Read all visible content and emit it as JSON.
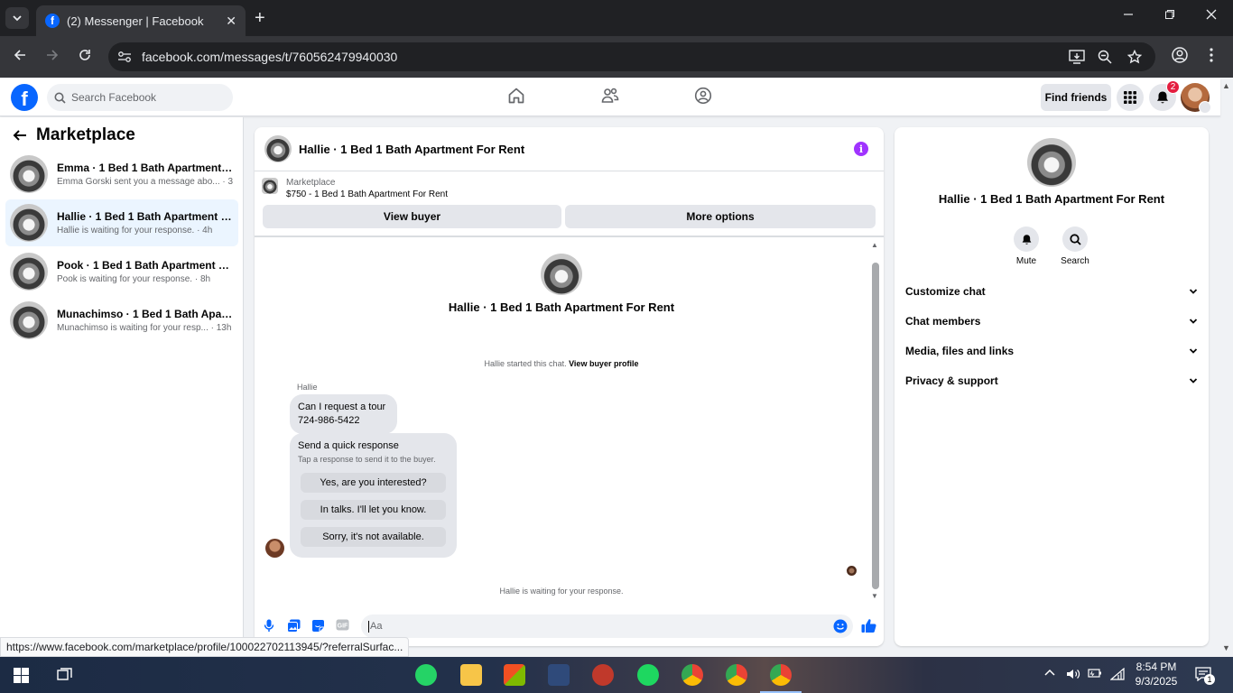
{
  "browser": {
    "tab_title": "(2) Messenger | Facebook",
    "favicon_letter": "f",
    "new_tab": "+",
    "close_tab": "✕",
    "url": "facebook.com/messages/t/760562479940030",
    "status_url": "https://www.facebook.com/marketplace/profile/100022702113945/?referralSurfac..."
  },
  "fb": {
    "logo_letter": "f",
    "search_placeholder": "Search Facebook",
    "find_friends": "Find friends",
    "notification_count": "2"
  },
  "left": {
    "title": "Marketplace",
    "conversations": [
      {
        "name": "Emma · 1 Bed 1 Bath Apartment Fo...",
        "sub": "Emma Gorski sent you a message abo... · 3h"
      },
      {
        "name": "Hallie · 1 Bed 1 Bath Apartment Fo...",
        "sub": "Hallie is waiting for your response. · 4h"
      },
      {
        "name": "Pook · 1 Bed 1 Bath Apartment For ...",
        "sub": "Pook is waiting for your response. · 8h"
      },
      {
        "name": "Munachimso · 1 Bed 1 Bath Apart...",
        "sub": "Munachimso is waiting for your resp... · 13h"
      }
    ]
  },
  "chat": {
    "title": "Hallie · 1 Bed 1 Bath Apartment For Rent",
    "listing_source": "Marketplace",
    "listing_price": "$750 - 1 Bed 1 Bath Apartment For Rent",
    "view_buyer": "View buyer",
    "more_options": "More options",
    "center_name": "Hallie · 1 Bed 1 Bath Apartment For Rent",
    "started_text": "Hallie started this chat.",
    "view_buyer_profile": "View buyer profile",
    "sender_name": "Hallie",
    "message_line1": "Can I request a tour",
    "message_line2": "724-986-5422",
    "quick_title": "Send a quick response",
    "quick_subtitle": "Tap a response to send it to the buyer.",
    "quick_responses": [
      "Yes, are you interested?",
      "In talks. I'll let you know.",
      "Sorry, it's not available."
    ],
    "waiting_text": "Hallie is waiting for your response.",
    "input_placeholder": "Aa"
  },
  "right": {
    "name": "Hallie · 1 Bed 1 Bath Apartment For Rent",
    "mute": "Mute",
    "search": "Search",
    "sections": [
      "Customize chat",
      "Chat members",
      "Media, files and links",
      "Privacy & support"
    ]
  },
  "taskbar": {
    "time": "8:54 PM",
    "date": "9/3/2025",
    "notification_count": "1"
  },
  "colors": {
    "fb_blue": "#0866ff",
    "accent_purple": "#a033ff",
    "badge_red": "#e41e3f"
  }
}
